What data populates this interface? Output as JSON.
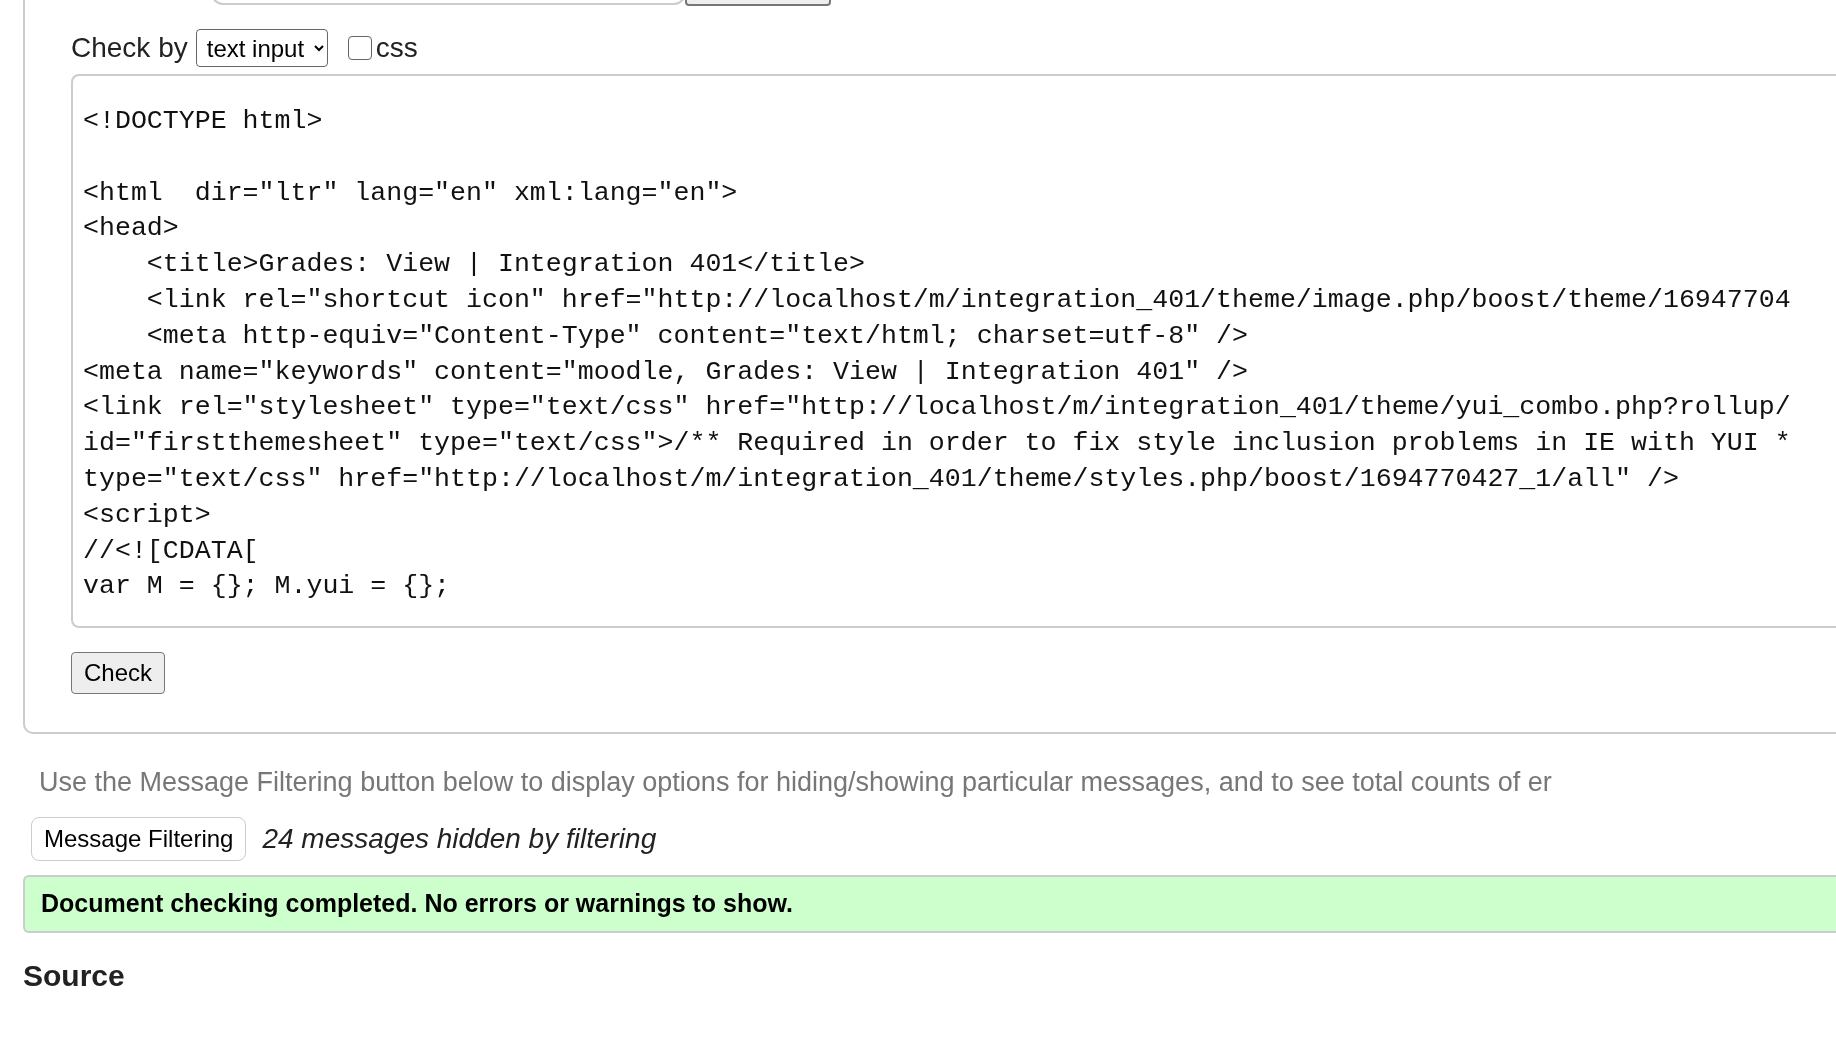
{
  "check_by": {
    "label": "Check by",
    "select_value": "text input",
    "css_option": {
      "label": "css",
      "checked": false
    }
  },
  "source_input": {
    "code": "<!DOCTYPE html>\n\n<html  dir=\"ltr\" lang=\"en\" xml:lang=\"en\">\n<head>\n    <title>Grades: View | Integration 401</title>\n    <link rel=\"shortcut icon\" href=\"http://localhost/m/integration_401/theme/image.php/boost/theme/16947704\n    <meta http-equiv=\"Content-Type\" content=\"text/html; charset=utf-8\" />\n<meta name=\"keywords\" content=\"moodle, Grades: View | Integration 401\" />\n<link rel=\"stylesheet\" type=\"text/css\" href=\"http://localhost/m/integration_401/theme/yui_combo.php?rollup/\nid=\"firstthemesheet\" type=\"text/css\">/** Required in order to fix style inclusion problems in IE with YUI *\ntype=\"text/css\" href=\"http://localhost/m/integration_401/theme/styles.php/boost/1694770427_1/all\" />\n<script>\n//<![CDATA[\nvar M = {}; M.yui = {};"
  },
  "check_button": "Check",
  "filter_hint": "Use the Message Filtering button below to display options for hiding/showing particular messages, and to see total counts of er",
  "filter_button": "Message Filtering",
  "hidden_count": "24 messages hidden by filtering",
  "result": {
    "kind": "success",
    "text": "Document checking completed. No errors or warnings to show."
  },
  "source_heading": "Source"
}
